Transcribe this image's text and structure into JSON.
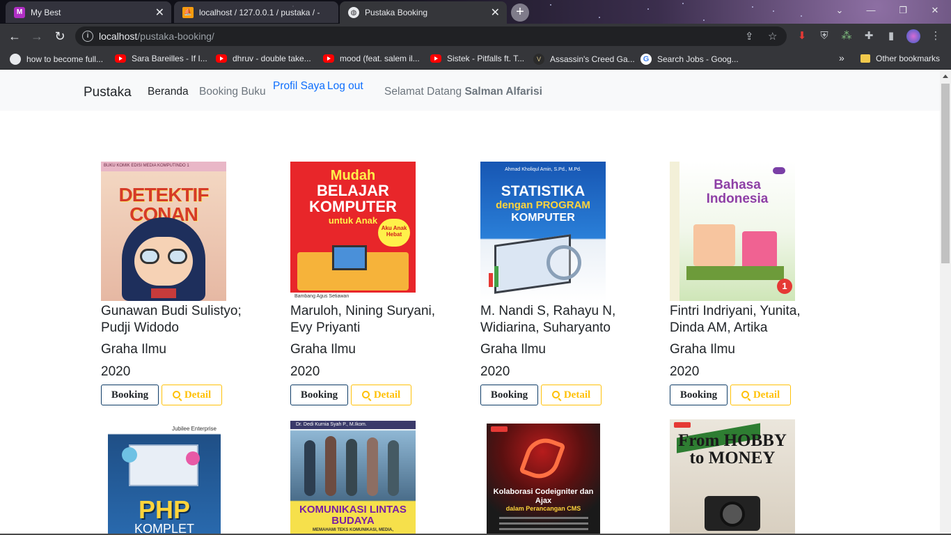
{
  "browser": {
    "tabs": [
      {
        "title": "My Best",
        "icon": "m-logo-icon"
      },
      {
        "title": "localhost / 127.0.0.1 / pustaka / -",
        "icon": "phpmyadmin-icon"
      },
      {
        "title": "Pustaka Booking",
        "icon": "globe-icon"
      }
    ],
    "url_host": "localhost",
    "url_path": "/pustaka-booking/",
    "bookmarks": [
      {
        "label": "how to become full...",
        "icon": "globe-icon"
      },
      {
        "label": "Sara Bareilles - If I...",
        "icon": "youtube-icon"
      },
      {
        "label": "dhruv - double take...",
        "icon": "youtube-icon"
      },
      {
        "label": "mood (feat. salem il...",
        "icon": "youtube-icon"
      },
      {
        "label": "Sistek - Pitfalls ft. T...",
        "icon": "youtube-icon"
      },
      {
        "label": "Assassin's Creed Ga...",
        "icon": "assassins-creed-icon"
      },
      {
        "label": "Search Jobs - Goog...",
        "icon": "google-icon"
      }
    ],
    "other_bookmarks": "Other bookmarks",
    "overflow": "»"
  },
  "navbar": {
    "brand": "Pustaka",
    "beranda": "Beranda",
    "booking_buku": "Booking Buku",
    "profil": "Profil Saya",
    "logout": "Log out",
    "welcome_prefix": "Selamat Datang",
    "user_name": "Salman Alfarisi"
  },
  "buttons": {
    "booking": "Booking",
    "detail": "Detail"
  },
  "books": [
    {
      "author": "Gunawan Budi Sulistyo; Pudji Widodo",
      "publisher": "Graha Ilmu",
      "year": "2020",
      "cover": {
        "top": "BUKU KOMIK EDISI MEDIA KOMPUTINDO 1",
        "title": "DETEKTIF CONAN"
      }
    },
    {
      "author": "Maruloh, Nining Suryani, Evy Priyanti",
      "publisher": "Graha Ilmu",
      "year": "2020",
      "cover": {
        "top": "Mudah",
        "title": "BELAJAR KOMPUTER",
        "sub": "untuk Anak",
        "badge": "Aku Anak Hebat",
        "writer": "Bambang Agus Setiawan"
      }
    },
    {
      "author": "M. Nandi S, Rahayu N, Widiarina, Suharyanto",
      "publisher": "Graha Ilmu",
      "year": "2020",
      "cover": {
        "top": "Ahmad Kholiqul Amin, S.Pd., M.Pd.",
        "title": "STATISTIKA",
        "sub": "dengan PROGRAM",
        "sub2": "KOMPUTER"
      }
    },
    {
      "author": "Fintri Indriyani, Yunita, Dinda AM, Artika",
      "publisher": "Graha Ilmu",
      "year": "2020",
      "cover": {
        "title": "Bahasa Indonesia",
        "badge": "1"
      }
    },
    {
      "cover": {
        "top": "Jubilee Enterprise",
        "title": "PHP",
        "sub": "KOMPLET"
      }
    },
    {
      "cover": {
        "top": "Dr. Dedi Kurnia Syah P., M.Ikom.",
        "title": "KOMUNIKASI LINTAS BUDAYA",
        "sub": "MEMAHAMI TEKS KOMUNIKASI, MEDIA,"
      }
    },
    {
      "cover": {
        "title": "Kolaborasi Codeigniter dan Ajax",
        "sub": "dalam Perancangan CMS"
      }
    },
    {
      "cover": {
        "title": "From HOBBY to MONEY"
      }
    }
  ],
  "colors": {
    "primary_link": "#0d6efd",
    "warning": "#ffc107",
    "navbar_bg": "#f8f9fa",
    "chrome_bg": "#35363a"
  }
}
